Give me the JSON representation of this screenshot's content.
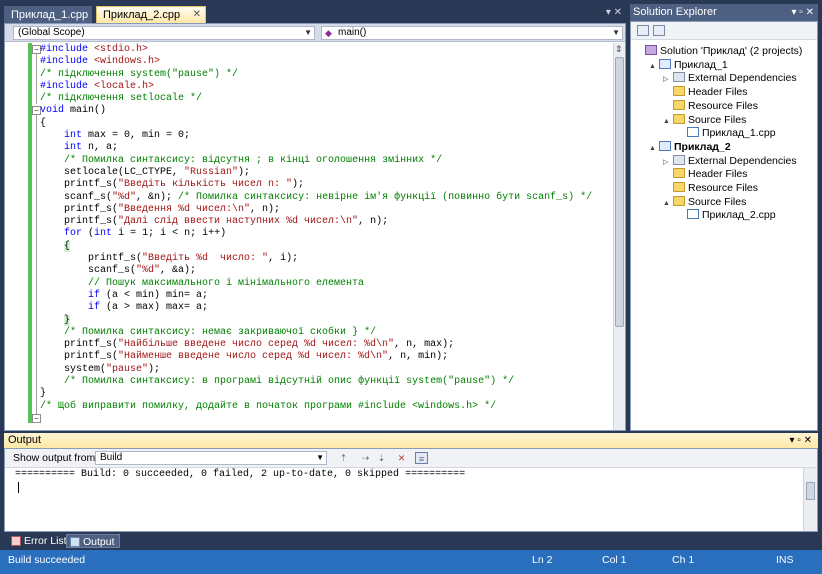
{
  "editor": {
    "tabs": [
      {
        "label": "Приклад_1.cpp",
        "active": false
      },
      {
        "label": "Приклад_2.cpp",
        "active": true
      }
    ],
    "scope_combo": "(Global Scope)",
    "function_combo": "main()",
    "code_lines": [
      [
        [
          "pp",
          "#include "
        ],
        [
          "str",
          "<stdio.h>"
        ]
      ],
      [
        [
          "pp",
          "#include "
        ],
        [
          "str",
          "<windows.h>"
        ]
      ],
      [
        [
          "cm",
          "/* підключення system(\"pause\") */"
        ]
      ],
      [
        [
          "pp",
          "#include "
        ],
        [
          "str",
          "<locale.h>"
        ]
      ],
      [
        [
          "cm",
          "/* підключення setlocale */"
        ]
      ],
      [
        [
          "kw",
          "void"
        ],
        [
          "tx",
          " main()"
        ]
      ],
      [
        [
          "tx",
          "{"
        ]
      ],
      [
        [
          "tx",
          "    "
        ],
        [
          "kw",
          "int"
        ],
        [
          "tx",
          " max = 0, min = 0;"
        ]
      ],
      [
        [
          "tx",
          "    "
        ],
        [
          "kw",
          "int"
        ],
        [
          "tx",
          " n, a;"
        ]
      ],
      [
        [
          "tx",
          "    "
        ],
        [
          "cm",
          "/* Помилка синтаксису: відсутня ; в кінці оголошення змінних */"
        ]
      ],
      [
        [
          "tx",
          "    setlocale(LC_CTYPE, "
        ],
        [
          "str",
          "\"Russian\""
        ],
        [
          "tx",
          ");"
        ]
      ],
      [
        [
          "tx",
          "    printf_s("
        ],
        [
          "str",
          "\"Введіть кількість чисел n: \""
        ],
        [
          "tx",
          ");"
        ]
      ],
      [
        [
          "tx",
          "    scanf_s("
        ],
        [
          "str",
          "\"%d\""
        ],
        [
          "tx",
          ", &n); "
        ],
        [
          "cm",
          "/* Помилка синтаксису: невірне ім'я функції (повинно бути scanf_s) */"
        ]
      ],
      [
        [
          "tx",
          "    printf_s("
        ],
        [
          "str",
          "\"Введення %d чисел:\\n\""
        ],
        [
          "tx",
          ", n);"
        ]
      ],
      [
        [
          "tx",
          "    printf_s("
        ],
        [
          "str",
          "\"Далі слід ввести наступних %d чисел:\\n\""
        ],
        [
          "tx",
          ", n);"
        ]
      ],
      [
        [
          "tx",
          "    "
        ],
        [
          "kw",
          "for"
        ],
        [
          "tx",
          " ("
        ],
        [
          "kw",
          "int"
        ],
        [
          "tx",
          " i = 1; i < n; i++)"
        ]
      ],
      [
        [
          "tx",
          "    "
        ],
        [
          "hl",
          "{"
        ]
      ],
      [
        [
          "tx",
          "        printf_s("
        ],
        [
          "str",
          "\"Введіть %d  число: \""
        ],
        [
          "tx",
          ", i);"
        ]
      ],
      [
        [
          "tx",
          "        scanf_s("
        ],
        [
          "str",
          "\"%d\""
        ],
        [
          "tx",
          ", &a);"
        ]
      ],
      [
        [
          "tx",
          "        "
        ],
        [
          "cm",
          "// Пошук максимального і мінімального елемента"
        ]
      ],
      [
        [
          "tx",
          "        "
        ],
        [
          "kw",
          "if"
        ],
        [
          "tx",
          " (a < min) min= a;"
        ]
      ],
      [
        [
          "tx",
          "        "
        ],
        [
          "kw",
          "if"
        ],
        [
          "tx",
          " (a > max) max= a;"
        ]
      ],
      [
        [
          "tx",
          "    "
        ],
        [
          "hl",
          "}"
        ]
      ],
      [
        [
          "tx",
          "    "
        ],
        [
          "cm",
          "/* Помилка синтаксису: немає закриваючої скобки } */"
        ]
      ],
      [
        [
          "tx",
          "    printf_s("
        ],
        [
          "str",
          "\"Найбільше введене число серед %d чисел: %d\\n\""
        ],
        [
          "tx",
          ", n, max);"
        ]
      ],
      [
        [
          "tx",
          "    printf_s("
        ],
        [
          "str",
          "\"Найменше введене число серед %d чисел: %d\\n\""
        ],
        [
          "tx",
          ", n, min);"
        ]
      ],
      [
        [
          "tx",
          "    system("
        ],
        [
          "str",
          "\"pause\""
        ],
        [
          "tx",
          ");"
        ]
      ],
      [
        [
          "tx",
          "    "
        ],
        [
          "cm",
          "/* Помилка синтаксису: в програмі відсутній опис функції system(\"pause\") */"
        ]
      ],
      [
        [
          "tx",
          "}"
        ]
      ],
      [
        [
          "cm",
          "/* Щоб виправити помилку, додайте в початок програми #include <windows.h> */"
        ]
      ]
    ]
  },
  "solution_explorer": {
    "title": "Solution Explorer",
    "tree": [
      {
        "label": "Solution 'Приклад' (2 projects)",
        "icon": "solution-icon",
        "level": 0,
        "expander": "",
        "bold": false
      },
      {
        "label": "Приклад_1",
        "icon": "project-icon",
        "level": 1,
        "expander": "▲",
        "bold": false
      },
      {
        "label": "External Dependencies",
        "icon": "references-icon",
        "level": 2,
        "expander": "▷",
        "bold": false
      },
      {
        "label": "Header Files",
        "icon": "folder-icon",
        "level": 2,
        "expander": "",
        "bold": false
      },
      {
        "label": "Resource Files",
        "icon": "folder-icon",
        "level": 2,
        "expander": "",
        "bold": false
      },
      {
        "label": "Source Files",
        "icon": "folder-icon",
        "level": 2,
        "expander": "▲",
        "bold": false
      },
      {
        "label": "Приклад_1.cpp",
        "icon": "cpp-file-icon",
        "level": 3,
        "expander": "",
        "bold": false
      },
      {
        "label": "Приклад_2",
        "icon": "project-icon",
        "level": 1,
        "expander": "▲",
        "bold": true
      },
      {
        "label": "External Dependencies",
        "icon": "references-icon",
        "level": 2,
        "expander": "▷",
        "bold": false
      },
      {
        "label": "Header Files",
        "icon": "folder-icon",
        "level": 2,
        "expander": "",
        "bold": false
      },
      {
        "label": "Resource Files",
        "icon": "folder-icon",
        "level": 2,
        "expander": "",
        "bold": false
      },
      {
        "label": "Source Files",
        "icon": "folder-icon",
        "level": 2,
        "expander": "▲",
        "bold": false
      },
      {
        "label": "Приклад_2.cpp",
        "icon": "cpp-file-icon",
        "level": 3,
        "expander": "",
        "bold": false
      }
    ]
  },
  "output": {
    "title": "Output",
    "show_from_label": "Show output from:",
    "show_from_value": "Build",
    "text": "========== Build: 0 succeeded, 0 failed, 2 up-to-date, 0 skipped =========="
  },
  "bottom_tabs": {
    "errors": "Error List",
    "output": "Output"
  },
  "status": {
    "message": "Build succeeded",
    "ln": "Ln 2",
    "col": "Col 1",
    "ch": "Ch 1",
    "mode": "INS"
  }
}
